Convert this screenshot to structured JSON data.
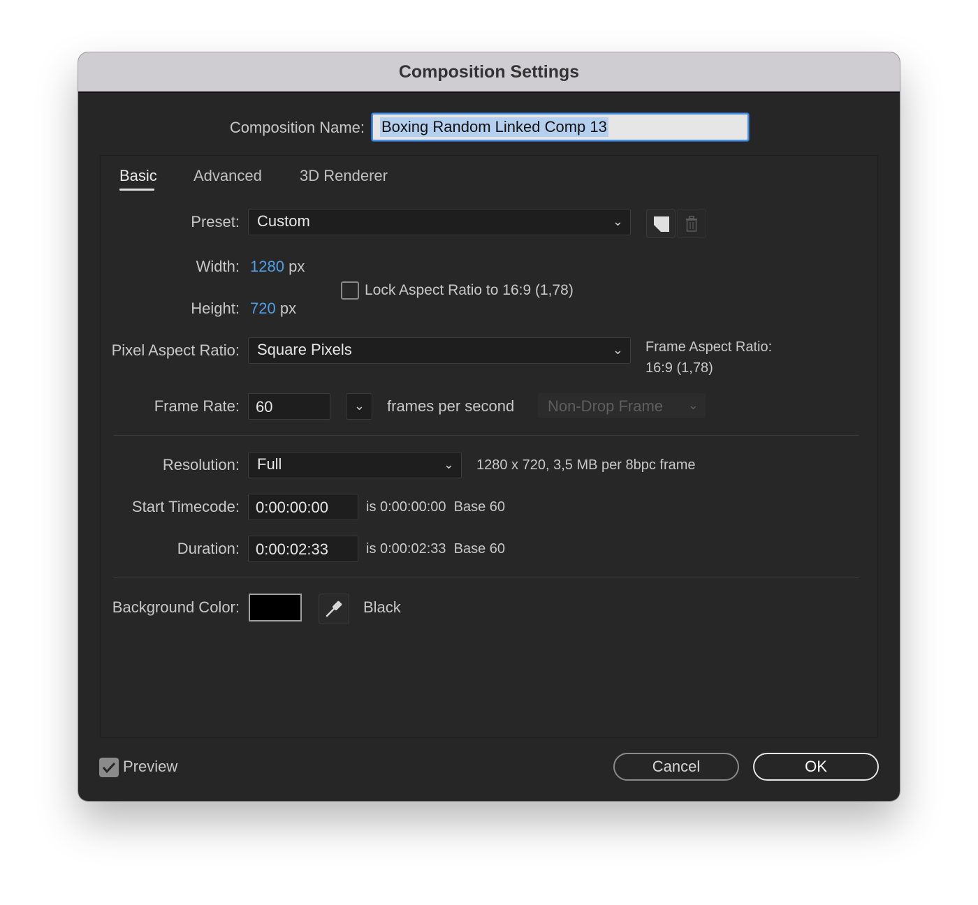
{
  "window": {
    "title": "Composition Settings"
  },
  "composition_name": {
    "label": "Composition Name:",
    "value": "Boxing Random Linked Comp 13"
  },
  "tabs": [
    {
      "label": "Basic",
      "active": true
    },
    {
      "label": "Advanced",
      "active": false
    },
    {
      "label": "3D Renderer",
      "active": false
    }
  ],
  "preset": {
    "label": "Preset:",
    "value": "Custom",
    "save_icon": "save-preset-icon",
    "delete_icon": "trash-icon"
  },
  "width": {
    "label": "Width:",
    "value": "1280",
    "unit": "px"
  },
  "height": {
    "label": "Height:",
    "value": "720",
    "unit": "px"
  },
  "lock_aspect": {
    "label": "Lock Aspect Ratio to 16:9 (1,78)",
    "checked": false
  },
  "pixel_aspect": {
    "label": "Pixel Aspect Ratio:",
    "value": "Square Pixels"
  },
  "frame_aspect": {
    "label": "Frame Aspect Ratio:",
    "value": "16:9 (1,78)"
  },
  "frame_rate": {
    "label": "Frame Rate:",
    "value": "60",
    "unit": "frames per second",
    "drop_frame": "Non-Drop Frame"
  },
  "resolution": {
    "label": "Resolution:",
    "value": "Full",
    "info": "1280 x 720, 3,5 MB per 8bpc frame"
  },
  "start_timecode": {
    "label": "Start Timecode:",
    "value": "0:00:00:00",
    "info": "is 0:00:00:00  Base 60"
  },
  "duration": {
    "label": "Duration:",
    "value": "0:00:02:33",
    "info": "is 0:00:02:33  Base 60"
  },
  "background": {
    "label": "Background Color:",
    "color": "#000000",
    "name": "Black"
  },
  "preview": {
    "label": "Preview",
    "checked": true
  },
  "buttons": {
    "cancel": "Cancel",
    "ok": "OK"
  },
  "colors": {
    "accent": "#4c9fe8",
    "dialog_bg": "#262626",
    "titlebar_bg": "#cfcdd2"
  }
}
